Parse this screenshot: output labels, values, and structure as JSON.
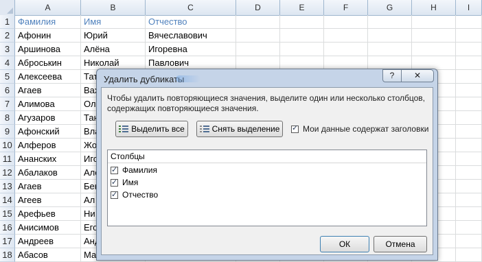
{
  "spreadsheet": {
    "columns": [
      "A",
      "B",
      "C",
      "D",
      "E",
      "F",
      "G",
      "H",
      "I"
    ],
    "rows": [
      {
        "num": "1",
        "a": "Фамилия",
        "b": "Имя",
        "c": "Отчество"
      },
      {
        "num": "2",
        "a": "Афонин",
        "b": "Юрий",
        "c": "Вячеславович"
      },
      {
        "num": "3",
        "a": "Аршинова",
        "b": "Алёна",
        "c": "Игоревна"
      },
      {
        "num": "4",
        "a": "Аброськин",
        "b": "Николай",
        "c": "Павлович"
      },
      {
        "num": "5",
        "a": "Алексеева",
        "b": "Тат",
        "c": ""
      },
      {
        "num": "6",
        "a": "Агаев",
        "b": "Вах",
        "c": ""
      },
      {
        "num": "7",
        "a": "Алимова",
        "b": "Ол",
        "c": ""
      },
      {
        "num": "8",
        "a": "Агузаров",
        "b": "Тан",
        "c": ""
      },
      {
        "num": "9",
        "a": "Афонский",
        "b": "Вла",
        "c": ""
      },
      {
        "num": "10",
        "a": "Алферов",
        "b": "Жо",
        "c": ""
      },
      {
        "num": "11",
        "a": "Ананских",
        "b": "Игс",
        "c": ""
      },
      {
        "num": "12",
        "a": "Абалаков",
        "b": "Але",
        "c": ""
      },
      {
        "num": "13",
        "a": "Агаев",
        "b": "Бен",
        "c": ""
      },
      {
        "num": "14",
        "a": "Агеев",
        "b": "Ал",
        "c": ""
      },
      {
        "num": "15",
        "a": "Арефьев",
        "b": "Ни",
        "c": ""
      },
      {
        "num": "16",
        "a": "Анисимов",
        "b": "Его",
        "c": ""
      },
      {
        "num": "17",
        "a": "Андреев",
        "b": "Анд",
        "c": ""
      },
      {
        "num": "18",
        "a": "Абасов",
        "b": "Ма",
        "c": ""
      }
    ]
  },
  "dialog": {
    "title": "Удалить дубликаты",
    "help_label": "?",
    "close_label": "✕",
    "description": "Чтобы удалить повторяющиеся значения, выделите один или несколько столбцов, содержащих повторяющиеся значения.",
    "select_all_label": "Выделить все",
    "unselect_all_label": "Снять выделение",
    "headers_checkbox_label": "Мои данные содержат заголовки",
    "headers_checked": true,
    "columns_header": "Столбцы",
    "column_items": [
      {
        "label": "Фамилия",
        "checked": true
      },
      {
        "label": "Имя",
        "checked": true
      },
      {
        "label": "Отчество",
        "checked": true
      }
    ],
    "ok_label": "ОК",
    "cancel_label": "Отмена"
  }
}
